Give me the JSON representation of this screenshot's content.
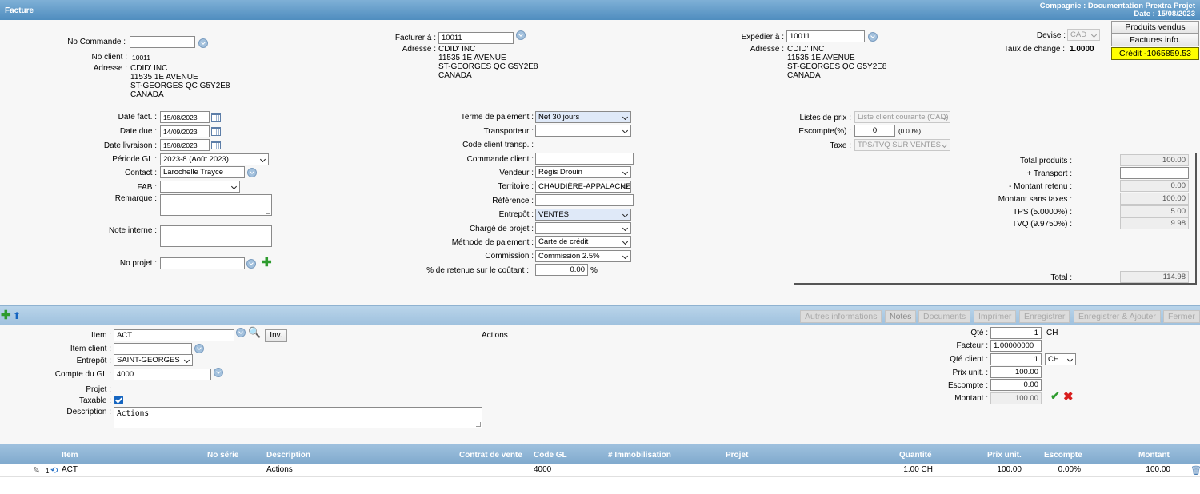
{
  "window": {
    "title": "Facture",
    "company": "Compagnie : Documentation Prextra Projet",
    "date": "Date : 15/08/2023"
  },
  "header": {
    "no_commande_label": "No Commande :",
    "no_commande": "",
    "no_client_label": "No client :",
    "no_client": "10011",
    "adresse_label": "Adresse :",
    "address": [
      "CDID' INC",
      "11535 1E AVENUE",
      "ST-GEORGES QC G5Y2E8",
      "CANADA"
    ],
    "facturer_label": "Facturer à :",
    "facturer": "10011",
    "expedier_label": "Expédier à :",
    "expedier": "10011",
    "devise_label": "Devise :",
    "devise": "CAD",
    "taux_label": "Taux de change :",
    "taux": "1.0000",
    "btn_produits": "Produits vendus",
    "btn_factures": "Factures info.",
    "credit": "Crédit -1065859.53"
  },
  "left": {
    "date_fact_label": "Date fact. :",
    "date_fact": "15/08/2023",
    "date_due_label": "Date due :",
    "date_due": "14/09/2023",
    "date_liv_label": "Date livraison :",
    "date_liv": "15/08/2023",
    "periode_label": "Période GL :",
    "periode": "2023-8 (Août 2023)",
    "contact_label": "Contact :",
    "contact": "Larochelle Trayce",
    "fab_label": "FAB :",
    "fab": "",
    "remarque_label": "Remarque :",
    "note_label": "Note interne :",
    "projet_label": "No projet :",
    "projet": ""
  },
  "mid": {
    "terme_label": "Terme de paiement :",
    "terme": "Net 30 jours",
    "transp_label": "Transporteur :",
    "transp": "",
    "codeclient_label": "Code client transp. :",
    "cmdclient_label": "Commande client :",
    "cmdclient": "",
    "vendeur_label": "Vendeur :",
    "vendeur": "Règis Drouin",
    "territoire_label": "Territoire :",
    "territoire": "CHAUDIÈRE-APPALACHES",
    "ref_label": "Référence :",
    "ref": "",
    "entrepot_label": "Entrepôt :",
    "entrepot": "VENTES",
    "charge_label": "Chargé de projet :",
    "charge": "",
    "methode_label": "Méthode de paiement :",
    "methode": "Carte de crédit",
    "commission_label": "Commission :",
    "commission": "Commission 2.5%",
    "retenue_label": "% de retenue sur le coûtant :",
    "retenue": "0.00",
    "pct": "%"
  },
  "right": {
    "listes_label": "Listes de prix :",
    "listes": "Liste client courante (CAD)",
    "escompte_label": "Escompte(%) :",
    "escompte": "0",
    "escompte_note": "(0.00%)",
    "taxe_label": "Taxe :",
    "taxe": "TPS/TVQ SUR VENTES",
    "totals": [
      {
        "label": "Total produits :",
        "value": "100.00"
      },
      {
        "label": "+ Transport :",
        "value": ""
      },
      {
        "label": "- Montant retenu :",
        "value": "0.00"
      },
      {
        "label": "Montant sans taxes :",
        "value": "100.00"
      },
      {
        "label": "TPS (5.0000%) :",
        "value": "5.00"
      },
      {
        "label": "TVQ (9.9750%) :",
        "value": "9.98"
      }
    ],
    "total_label": "Total :",
    "total": "114.98"
  },
  "toolbar": {
    "autres": "Autres informations",
    "notes": "Notes",
    "documents": "Documents",
    "imprimer": "Imprimer",
    "enregistrer": "Enregistrer",
    "enreg_ajouter": "Enregistrer & Ajouter",
    "fermer": "Fermer"
  },
  "item": {
    "item_label": "Item :",
    "item": "ACT",
    "inv": "Inv.",
    "actions": "Actions",
    "item_client_label": "Item client :",
    "item_client": "",
    "entrepot_label": "Entrepôt :",
    "entrepot": "SAINT-GEORGES",
    "compte_label": "Compte du GL :",
    "compte": "4000",
    "projet_label": "Projet :",
    "taxable_label": "Taxable :",
    "desc_label": "Description :",
    "desc": "Actions",
    "qte_label": "Qté :",
    "qte": "1",
    "qte_unit": "CH",
    "facteur_label": "Facteur :",
    "facteur": "1.00000000",
    "qte_client_label": "Qté client :",
    "qte_client": "1",
    "qte_client_unit": "CH",
    "prix_label": "Prix unit. :",
    "prix": "100.00",
    "escompte_label": "Escompte :",
    "escompte": "0.00",
    "montant_label": "Montant :",
    "montant": "100.00"
  },
  "grid": {
    "headers": {
      "item": "Item",
      "serie": "No série",
      "desc": "Description",
      "contrat": "Contrat de vente",
      "codegl": "Code GL",
      "immo": "# Immobilisation",
      "projet": "Projet",
      "qte": "Quantité",
      "prix": "Prix unit.",
      "escompte": "Escompte",
      "montant": "Montant"
    },
    "rows": [
      {
        "item": "ACT",
        "desc": "Actions",
        "codegl": "4000",
        "qte": "1.00 CH",
        "prix": "100.00",
        "escompte": "0.00%",
        "montant": "100.00"
      }
    ]
  }
}
